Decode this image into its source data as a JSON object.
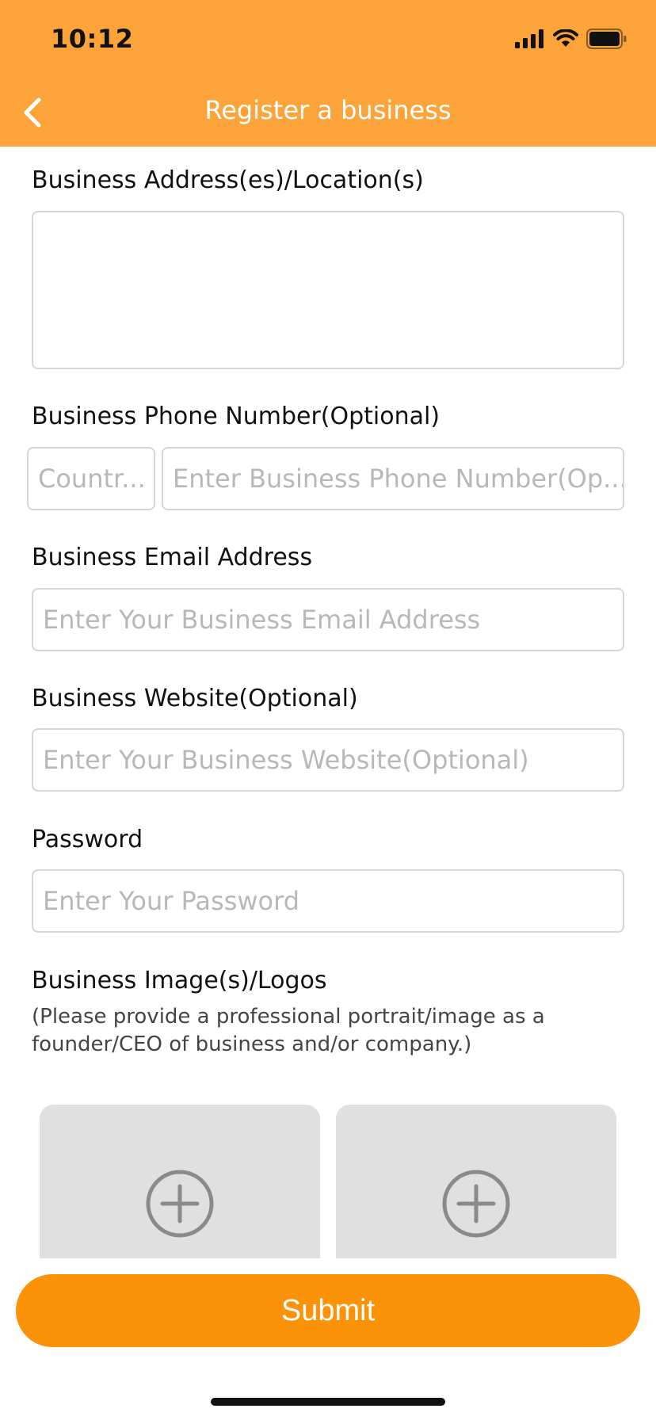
{
  "status_bar": {
    "time": "10:12"
  },
  "header": {
    "title": "Register a business"
  },
  "form": {
    "address_label": "Business Address(es)/Location(s)",
    "address_value": "",
    "phone_label": "Business Phone Number(Optional)",
    "country_placeholder": "Countr...",
    "phone_placeholder": "Enter Business Phone Number(Op...",
    "email_label": "Business Email Address",
    "email_placeholder": "Enter Your Business Email Address",
    "website_label": "Business Website(Optional)",
    "website_placeholder": "Enter Your Business Website(Optional)",
    "password_label": "Password",
    "password_placeholder": "Enter Your Password",
    "images_label": "Business Image(s)/Logos",
    "images_helper": "(Please provide a professional portrait/image as a founder/CEO of business and/or company.)"
  },
  "actions": {
    "submit_label": "Submit"
  },
  "colors": {
    "header": "#FCA33A",
    "submit": "#FB9207",
    "tile": "#e0e0e0"
  }
}
